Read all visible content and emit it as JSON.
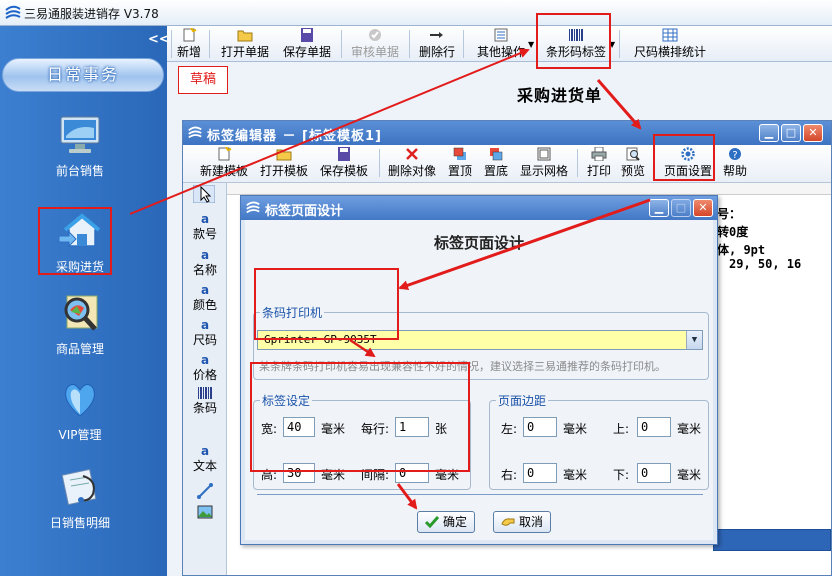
{
  "app": {
    "title": "三易通服装进销存 V3.78"
  },
  "sidebar": {
    "collapse_glyph": "<<",
    "header": "日常事务",
    "items": [
      {
        "label": "前台销售",
        "icon": "monitor-icon"
      },
      {
        "label": "采购进货",
        "icon": "house-import-icon"
      },
      {
        "label": "商品管理",
        "icon": "magnifier-map-icon"
      },
      {
        "label": "VIP管理",
        "icon": "vip-heart-icon"
      },
      {
        "label": "日销售明细",
        "icon": "stethoscope-report-icon"
      }
    ]
  },
  "toolbar": {
    "new": "新增",
    "open": "打开单据",
    "save": "保存单据",
    "approve": "审核单据",
    "delete_row": "删除行",
    "other_ops": "其他操作",
    "barcode_label": "条形码标签",
    "size_stats": "尺码横排统计"
  },
  "document": {
    "status": "草稿"
  },
  "annotation": {
    "purchase_note": "采购进货单"
  },
  "editor": {
    "title": "标签编辑器 － [标签模板1]",
    "toolbar": {
      "new_template": "新建模板",
      "open_template": "打开模板",
      "save_template": "保存模板",
      "delete_object": "删除对像",
      "bring_top": "置顶",
      "send_bottom": "置底",
      "show_grid": "显示网格",
      "print": "打印",
      "preview": "预览",
      "page_setup": "页面设置",
      "help": "帮助"
    },
    "tools": [
      "款号",
      "名称",
      "颜色",
      "尺码",
      "价格",
      "条码",
      "文本"
    ],
    "tool_glyph": "a",
    "properties": {
      "p1": "号：",
      "p2": "转0度",
      "p3": "体, 9pt",
      "p4": "29, 50, 16"
    }
  },
  "dialog": {
    "title": "标签页面设计",
    "heading": "标签页面设计",
    "printer_group": "条码打印机",
    "printer_value": "Gprinter  GP-9035T",
    "hint": "某条牌条码打印机容易出现兼容性不好的情况，建议选择三易通推荐的条码打印机。",
    "label_group": "标签设定",
    "width_label": "宽:",
    "width_value": "40",
    "width_unit": "毫米",
    "per_row_label": "每行:",
    "per_row_value": "1",
    "per_row_unit": "张",
    "height_label": "高:",
    "height_value": "30",
    "height_unit": "毫米",
    "gap_label": "间隔:",
    "gap_value": "0",
    "gap_unit": "毫米",
    "margin_group": "页面边距",
    "left_label": "左:",
    "left_value": "0",
    "left_unit": "毫米",
    "top_label": "上:",
    "top_value": "0",
    "top_unit": "毫米",
    "right_label": "右:",
    "right_value": "0",
    "right_unit": "毫米",
    "bottom_label": "下:",
    "bottom_value": "0",
    "bottom_unit": "毫米",
    "ok": "确定",
    "cancel": "取消"
  },
  "colors": {
    "sidebar": "#2f6fc3",
    "annotation": "#e21b1b",
    "title_bar": "#4a7fc8",
    "printer_field": "#ffffa8"
  }
}
